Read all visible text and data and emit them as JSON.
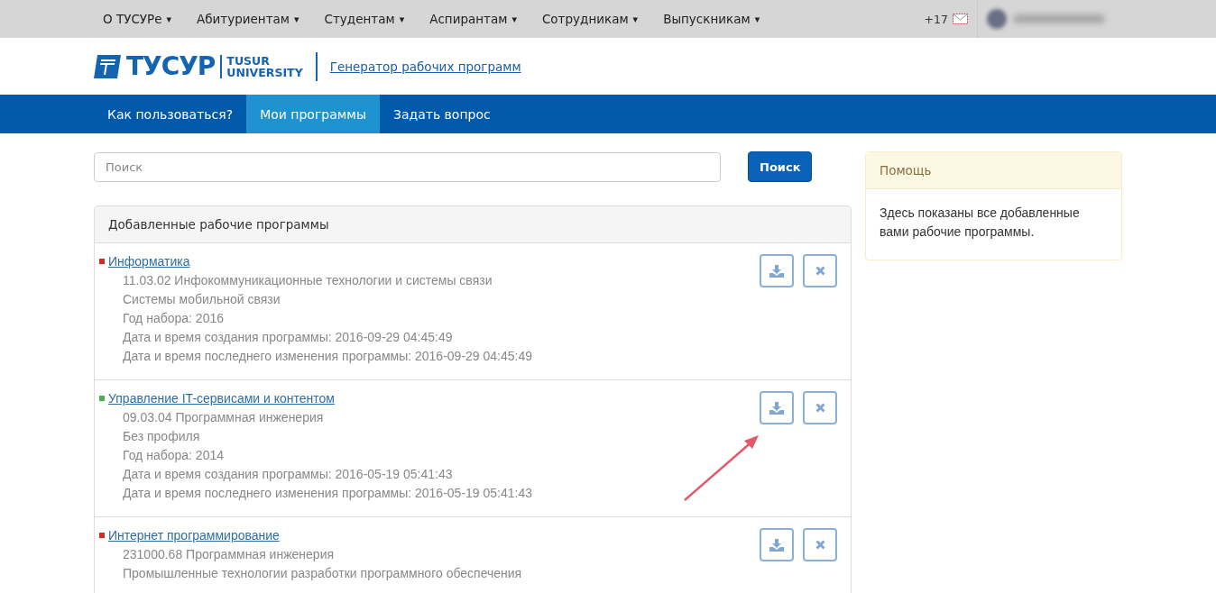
{
  "top_menu": [
    {
      "label": "О ТУСУРе",
      "caret": "▾"
    },
    {
      "label": "Абитуриентам",
      "caret": "▾"
    },
    {
      "label": "Студентам",
      "caret": "▾"
    },
    {
      "label": "Аспирантам",
      "caret": "▾"
    },
    {
      "label": "Сотрудникам",
      "caret": "▾"
    },
    {
      "label": "Выпускникам",
      "caret": "▾"
    }
  ],
  "messages": {
    "count": "+17"
  },
  "header": {
    "logo_text": "ТУСУР",
    "logo_sub": [
      "TUSUR",
      "UNIVERSITY"
    ],
    "site_link": "Генератор рабочих программ"
  },
  "nav_tabs": [
    {
      "label": "Как пользоваться?",
      "selected": false
    },
    {
      "label": "Мои программы",
      "selected": true
    },
    {
      "label": "Задать вопрос",
      "selected": false
    }
  ],
  "search": {
    "placeholder": "Поиск",
    "button": "Поиск"
  },
  "panel": {
    "title": "Добавленные рабочие программы",
    "programs": [
      {
        "title": "Информатика",
        "color": "#c9302c",
        "details": [
          "11.03.02 Инфокоммуникационные технологии и системы связи",
          "Системы мобильной связи",
          "Год набора: 2016",
          "Дата и время создания программы: 2016-09-29 04:45:49",
          "Дата и время последнего изменения программы: 2016-09-29 04:45:49"
        ]
      },
      {
        "title": "Управление IT-сервисами и контентом",
        "color": "#4cae4c",
        "details": [
          "09.03.04 Программная инженерия",
          "Без профиля",
          "Год набора: 2014",
          "Дата и время создания программы: 2016-05-19 05:41:43",
          "Дата и время последнего изменения программы: 2016-05-19 05:41:43"
        ]
      },
      {
        "title": "Интернет программирование",
        "color": "#c9302c",
        "details": [
          "231000.68 Программная инженерия",
          "Промышленные технологии разработки программного обеспечения"
        ]
      }
    ]
  },
  "help": {
    "title": "Помощь",
    "text": "Здесь показаны все добавленные вами рабочие программы."
  }
}
